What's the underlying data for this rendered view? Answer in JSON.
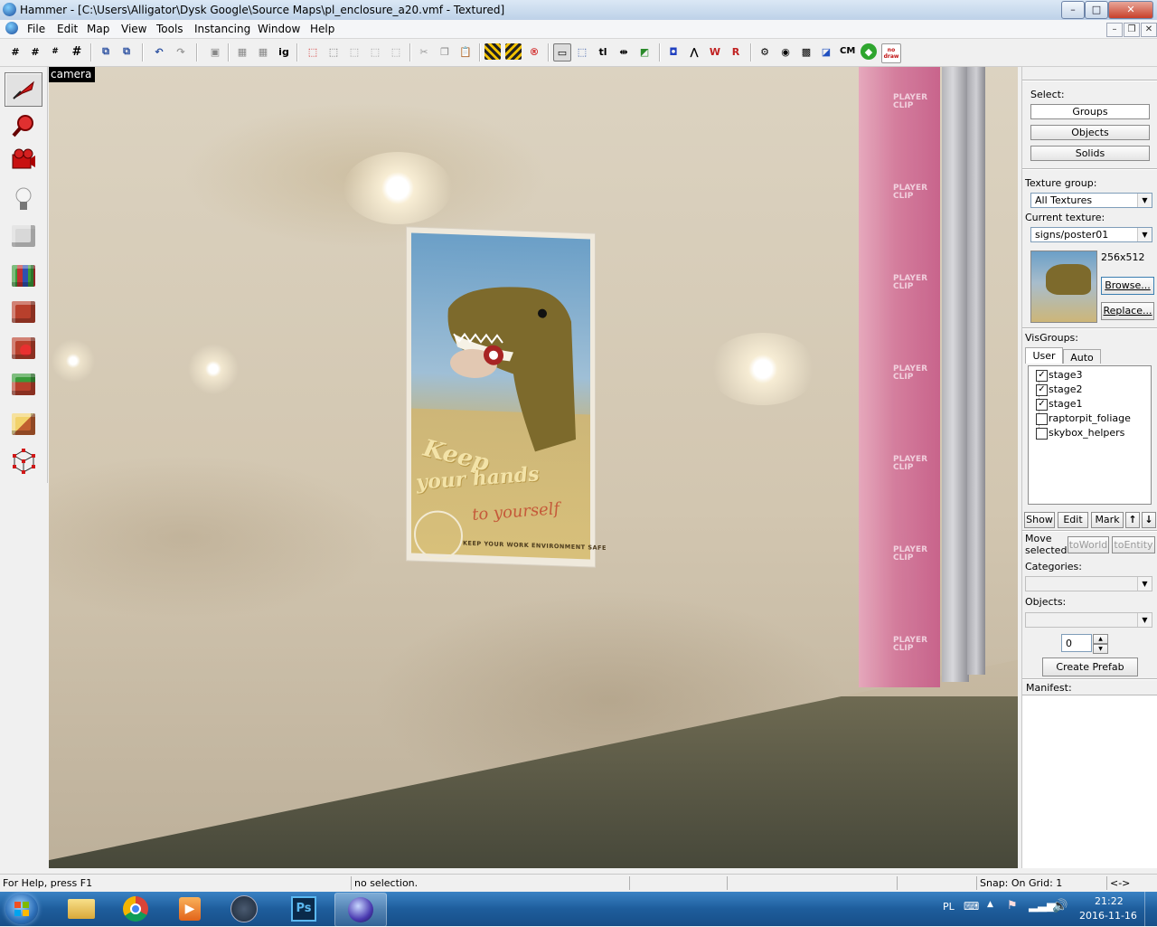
{
  "window": {
    "title": "Hammer - [C:\\Users\\Alligator\\Dysk Google\\Source Maps\\pl_enclosure_a20.vmf - Textured]",
    "minimize": "–",
    "maximize": "□",
    "close": "✕"
  },
  "menubar": {
    "items": [
      "File",
      "Edit",
      "Map",
      "View",
      "Tools",
      "Instancing",
      "Window",
      "Help"
    ],
    "mdi_minimize": "–",
    "mdi_restore": "❐",
    "mdi_close": "✕"
  },
  "toolbar": {
    "text_buttons": [
      "ig",
      "tl",
      "CM"
    ],
    "nodraw_label": "no draw"
  },
  "viewport": {
    "label": "camera",
    "poster": {
      "line1": "Keep",
      "line2": "your hands",
      "line3": "to yourself",
      "footer": "KEEP YOUR WORK ENVIRONMENT SAFE"
    },
    "clip_text": "PLAYER CLIP"
  },
  "rightpanel": {
    "select_label": "Select:",
    "select_buttons": [
      "Groups",
      "Objects",
      "Solids"
    ],
    "texture_group_label": "Texture group:",
    "texture_group_value": "All Textures",
    "current_texture_label": "Current texture:",
    "current_texture_value": "signs/poster01",
    "texture_size": "256x512",
    "browse_button": "Browse...",
    "replace_button": "Replace...",
    "visgroups_label": "VisGroups:",
    "visgroup_tabs": [
      "User",
      "Auto"
    ],
    "visgroups": [
      {
        "name": "stage3",
        "checked": true
      },
      {
        "name": "stage2",
        "checked": true
      },
      {
        "name": "stage1",
        "checked": true
      },
      {
        "name": "raptorpit_foliage",
        "checked": false
      },
      {
        "name": "skybox_helpers",
        "checked": false
      }
    ],
    "vis_buttons": [
      "Show",
      "Edit",
      "Mark"
    ],
    "move_selected_label": "Move selected:",
    "to_world_button": "toWorld",
    "to_entity_button": "toEntity",
    "categories_label": "Categories:",
    "objects_label": "Objects:",
    "prefab_count": "0",
    "create_prefab_button": "Create Prefab",
    "manifest_label": "Manifest:"
  },
  "statusbar": {
    "help": "For Help, press F1",
    "selection": "no selection.",
    "snap": "Snap: On Grid: 1",
    "arrows": "<->"
  },
  "taskbar": {
    "language": "PL",
    "time": "21:22",
    "date": "2016-11-16"
  },
  "colors": {
    "taskbar": "#1e5d9c",
    "player_clip": "#d47a9c",
    "selection_accent": "#3399ff"
  }
}
